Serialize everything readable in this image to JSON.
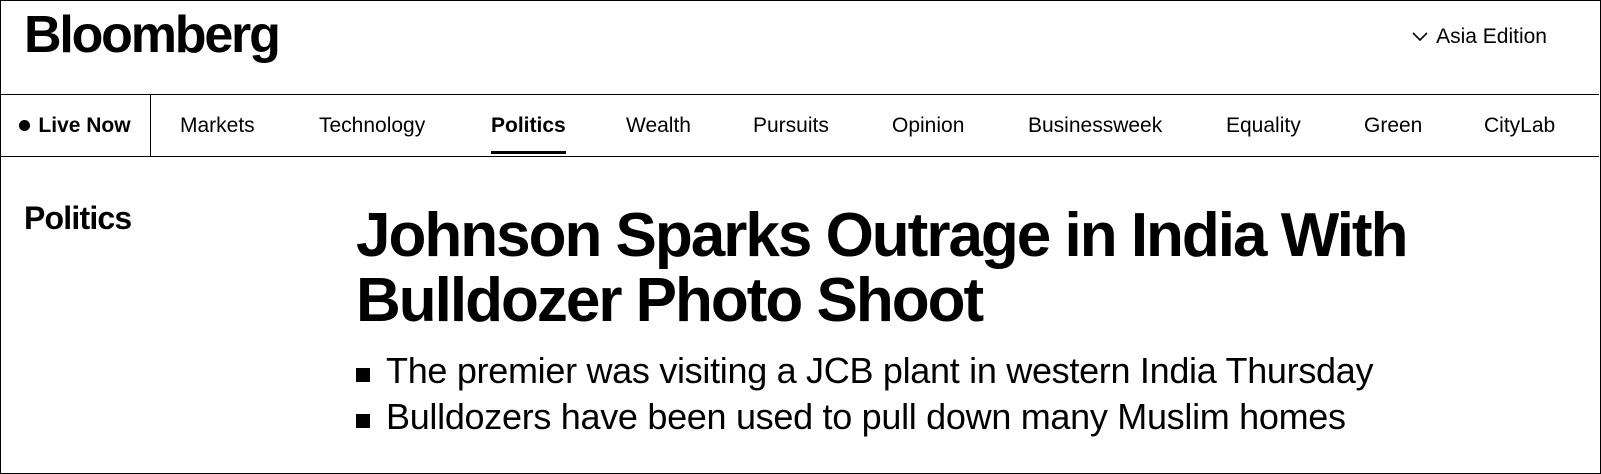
{
  "header": {
    "logo": "Bloomberg",
    "edition_label": "Asia Edition"
  },
  "nav": {
    "live_now": "Live Now",
    "items": [
      {
        "label": "Markets"
      },
      {
        "label": "Technology"
      },
      {
        "label": "Politics",
        "active": true
      },
      {
        "label": "Wealth"
      },
      {
        "label": "Pursuits"
      },
      {
        "label": "Opinion"
      },
      {
        "label": "Businessweek"
      },
      {
        "label": "Equality"
      },
      {
        "label": "Green"
      },
      {
        "label": "CityLab"
      }
    ]
  },
  "article": {
    "section": "Politics",
    "headline": "Johnson Sparks Outrage in India With Bulldozer Photo Shoot",
    "bullets": [
      "The premier was visiting a JCB plant in western India Thursday",
      "Bulldozers have been used to pull down many Muslim homes"
    ]
  },
  "icons": {
    "edition": "chevron-down-icon",
    "live": "live-dot-icon"
  }
}
